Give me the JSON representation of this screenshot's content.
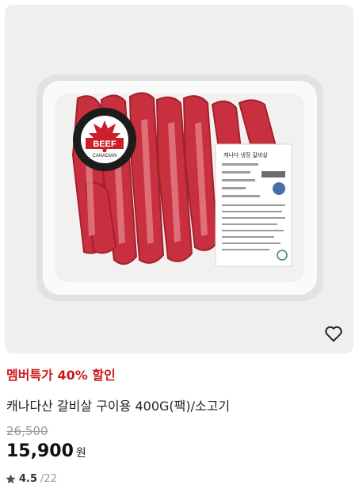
{
  "product": {
    "image_label": {
      "badge_text": "BEEF",
      "badge_sub": "CANADIAN",
      "sticker_title": "캐나다 냉장 갈비살"
    },
    "wishlist_icon": "heart-outline-icon",
    "promo": "멤버특가 40% 할인",
    "title": "캐나다산 갈비살 구이용 400G(팩)/소고기",
    "original_price": "26,500",
    "price": "15,900",
    "currency": "원",
    "rating": "4.5",
    "rating_separator": "/",
    "review_count": "22",
    "colors": {
      "promo": "#cc1919",
      "strike": "#9a9a9a",
      "star": "#555555"
    }
  }
}
